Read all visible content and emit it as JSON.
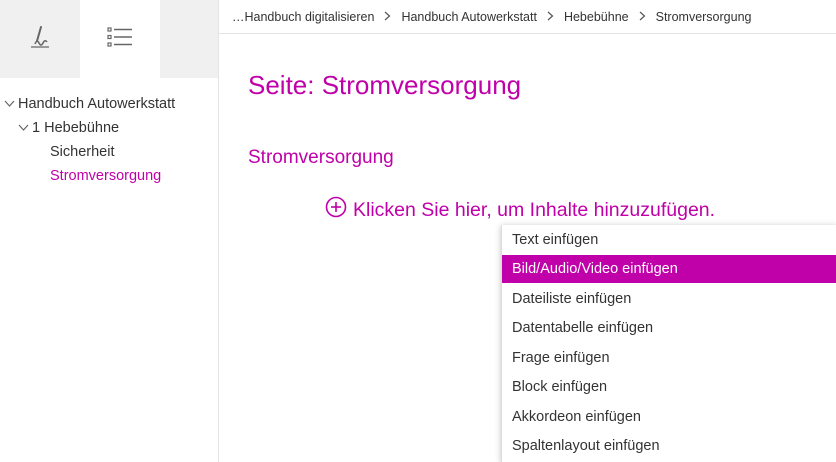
{
  "breadcrumb": {
    "items": [
      "…Handbuch digitalisieren",
      "Handbuch Autowerkstatt",
      "Hebebühne",
      "Stromversorgung"
    ]
  },
  "sidebar": {
    "tabs": [
      {
        "icon": "signature-icon"
      },
      {
        "icon": "list-icon"
      }
    ],
    "tree": [
      {
        "label": "Handbuch Autowerkstatt",
        "expanded": true
      },
      {
        "label": "1 Hebebühne",
        "expanded": true
      },
      {
        "label": "Sicherheit"
      },
      {
        "label": "Stromversorgung",
        "selected": true
      }
    ]
  },
  "main": {
    "page_title": "Seite: Stromversorgung",
    "section_title": "Stromversorgung",
    "add_content_label": "Klicken Sie hier, um Inhalte hinzuzufügen."
  },
  "menu": {
    "items": [
      {
        "label": "Text einfügen"
      },
      {
        "label": "Bild/Audio/Video einfügen",
        "highlighted": true
      },
      {
        "label": "Dateiliste einfügen"
      },
      {
        "label": "Datentabelle einfügen"
      },
      {
        "label": "Frage einfügen"
      },
      {
        "label": "Block einfügen"
      },
      {
        "label": "Akkordeon einfügen"
      },
      {
        "label": "Spaltenlayout einfügen"
      }
    ]
  },
  "colors": {
    "accent": "#c000a8",
    "panel_bg": "#f0f0f0",
    "text": "#333333"
  }
}
